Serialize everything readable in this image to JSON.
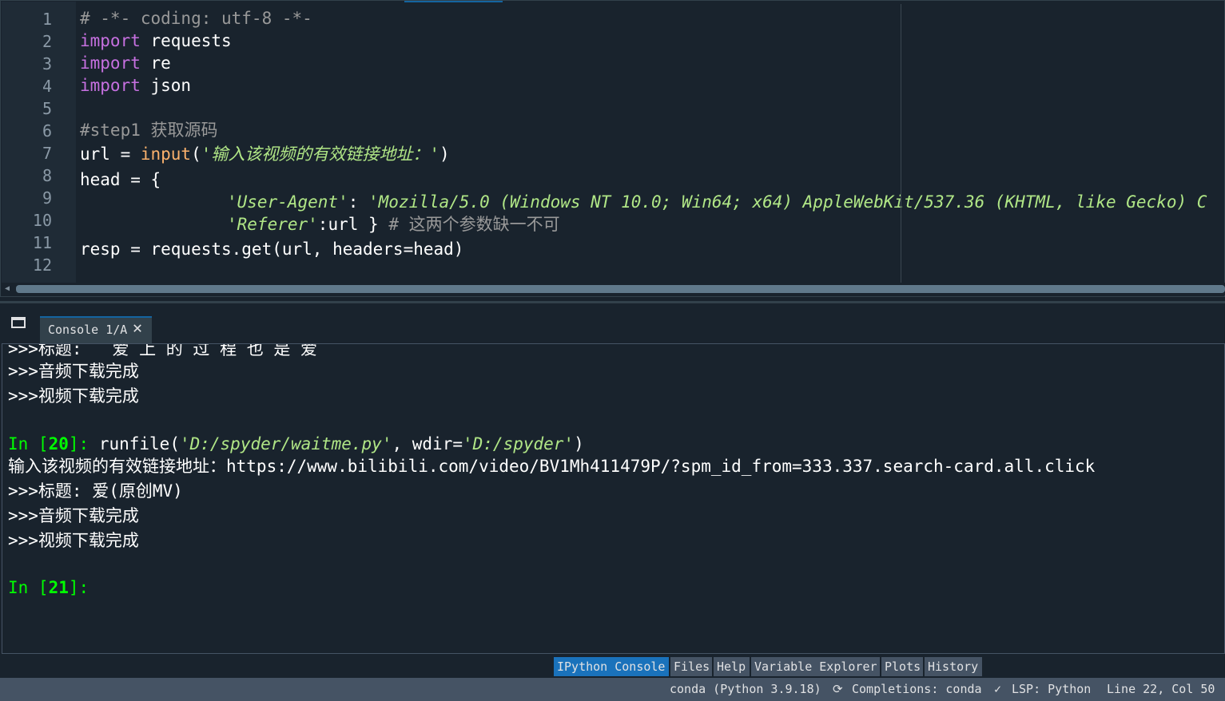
{
  "editor": {
    "line_numbers": [
      "1",
      "2",
      "3",
      "4",
      "5",
      "6",
      "7",
      "8",
      "9",
      "10",
      "11",
      "12"
    ],
    "lines": {
      "l1": "# -*- coding: utf-8 -*-",
      "l2_kw": "import",
      "l2_rest": " requests",
      "l3_kw": "import",
      "l3_rest": " re",
      "l4_kw": "import",
      "l4_rest": " json",
      "l6": "#step1 获取源码",
      "l7_a": "url = ",
      "l7_fn": "input",
      "l7_b": "(",
      "l7_str": "'输入该视频的有效链接地址：'",
      "l7_c": ")",
      "l8": "head = {",
      "l9_key": "'User-Agent'",
      "l9_colon": ": ",
      "l9_val": "'Mozilla/5.0 (Windows NT 10.0; Win64; x64) AppleWebKit/537.36 (KHTML, like Gecko) C",
      "l10_key": "'Referer'",
      "l10_rest": ":url } ",
      "l10_cm": "# 这两个参数缺一不可",
      "l11": "resp = requests.get(url, headers=head)"
    }
  },
  "console_tab": {
    "label": "Console 1/A",
    "close_icon": "close-icon"
  },
  "console": {
    "partial": ">>>标题:   爱 上 的 过 程 也 是 爱",
    "o1": ">>>音频下载完成",
    "o2": ">>>视频下载完成",
    "in20_prompt_a": "In [",
    "in20_num": "20",
    "in20_prompt_b": "]: ",
    "in20_a": "runfile(",
    "in20_s1": "'D:/spyder/waitme.py'",
    "in20_b": ", wdir=",
    "in20_s2": "'D:/spyder'",
    "in20_c": ")",
    "input_line": "输入该视频的有效链接地址：https://www.bilibili.com/video/BV1Mh411479P/?spm_id_from=333.337.search-card.all.click",
    "o3": ">>>标题: 爱(原创MV)",
    "o4": ">>>音频下载完成",
    "o5": ">>>视频下载完成",
    "in21_prompt_a": "In [",
    "in21_num": "21",
    "in21_prompt_b": "]:"
  },
  "bottom_tabs": [
    "IPython Console",
    "Files",
    "Help",
    "Variable Explorer",
    "Plots",
    "History"
  ],
  "statusbar": {
    "env": "conda (Python 3.9.18)",
    "completions": "Completions: conda",
    "lsp": "LSP: Python",
    "position": "Line 22, Col 50"
  },
  "colors": {
    "background": "#19232d",
    "keyword": "#c670e0",
    "builtin": "#fab16c",
    "string": "#b0e686",
    "prompt": "#00ff00",
    "accent": "#1a72bb"
  }
}
